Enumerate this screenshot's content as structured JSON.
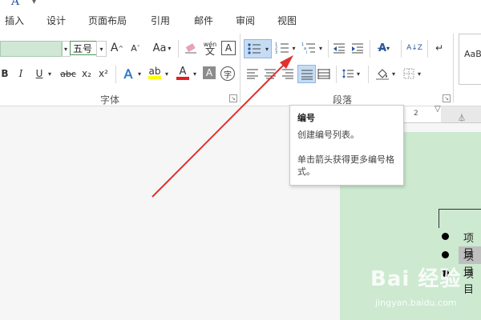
{
  "qat": {
    "app_icon": "A"
  },
  "tabs": [
    "插入",
    "设计",
    "页面布局",
    "引用",
    "邮件",
    "审阅",
    "视图"
  ],
  "font": {
    "size_value": "五号",
    "grow_label": "A",
    "case_label": "Aa",
    "phonetic_top": "wén",
    "phonetic_bottom": "文",
    "border_char": "A",
    "bold": "B",
    "italic": "I",
    "underline": "U",
    "strike": "abc",
    "subscript": "x₂",
    "superscript": "x²",
    "effects": "A",
    "font_color": "A",
    "shading_char": "A",
    "enclose_char": "字",
    "group_label": "字体"
  },
  "paragraph": {
    "group_label": "段落",
    "sort": "A↓Z"
  },
  "styles": {
    "sample": "AaBl"
  },
  "ruler": {
    "number": "2"
  },
  "tooltip": {
    "title": "编号",
    "line1": "创建编号列表。",
    "line2": "单击箭头获得更多编号格式。"
  },
  "document": {
    "items": [
      "项目",
      "项目",
      "项目"
    ]
  },
  "watermark": {
    "main": "Bai 经验",
    "sub": "jingyan.baidu.com"
  },
  "colors": {
    "accent": "#2b579a",
    "highlight": "#ffff00",
    "font_red": "#e02020",
    "page_green": "#cde9d0",
    "arrow_red": "#e03030",
    "active_blue": "#c5dcf3"
  }
}
